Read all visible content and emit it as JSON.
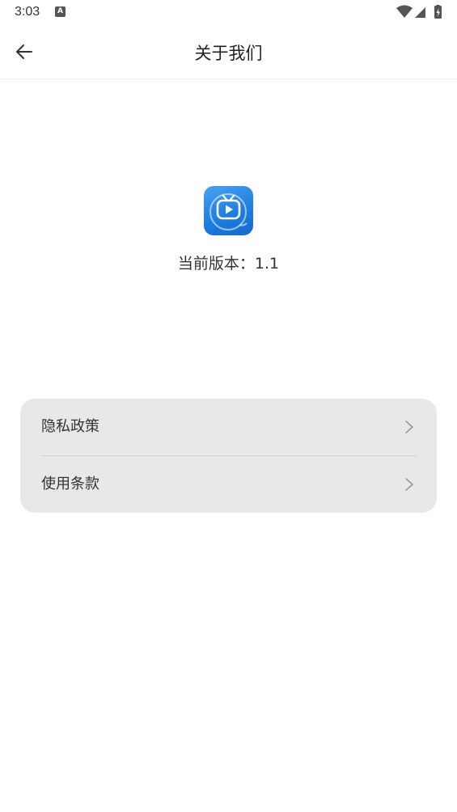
{
  "status_bar": {
    "time": "3:03",
    "notification_icon": "A"
  },
  "toolbar": {
    "title": "关于我们",
    "back_icon": "arrow-left-icon"
  },
  "about": {
    "app_icon": "tv-play-icon",
    "version_label": "当前版本：",
    "version_value": "1.1"
  },
  "menu": {
    "items": [
      {
        "label": "隐私政策",
        "icon": "chevron-right-icon"
      },
      {
        "label": "使用条款",
        "icon": "chevron-right-icon"
      }
    ]
  },
  "colors": {
    "app_icon_blue": "#1f7fe0",
    "card_background": "#e8e8e8",
    "page_background": "#ffffff"
  }
}
